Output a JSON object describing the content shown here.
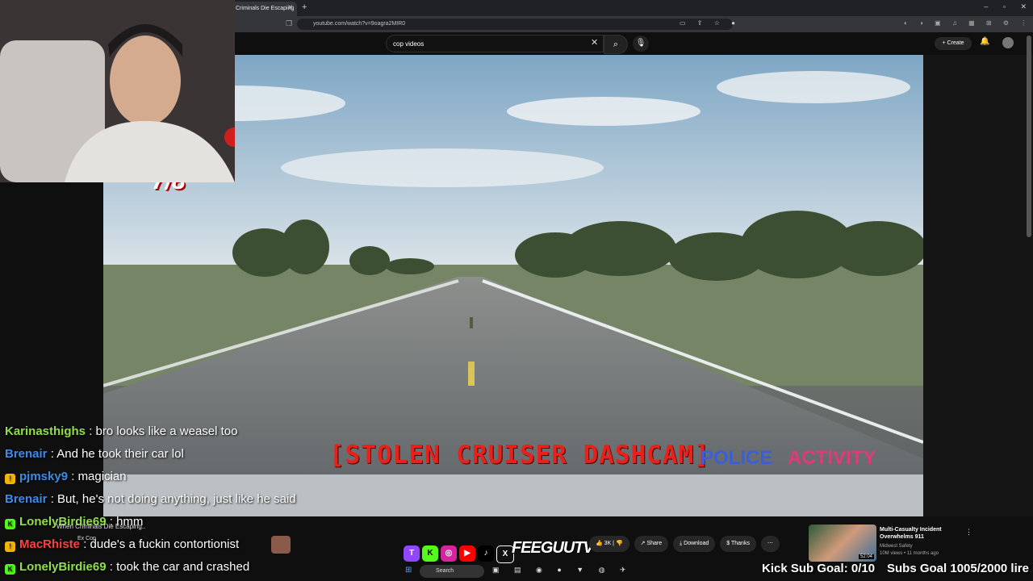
{
  "browser": {
    "tab_title": "Criminals Die Escaping",
    "url": "youtube.com/watch?v=9oagra2MIR0"
  },
  "youtube": {
    "search_value": "cop videos",
    "create_label": "Create",
    "actions": {
      "likes": "3K",
      "share": "Share",
      "download": "Download",
      "thanks": "Thanks"
    },
    "recommended": {
      "title": "Multi-Casualty Incident Overwhelms 911",
      "channel": "Midwest Safety",
      "meta": "10M views • 11 months ago",
      "duration": "52:04"
    },
    "mini_popup": {
      "video_title": "When Criminals Die Escaping..",
      "channel": "Ex Cop"
    }
  },
  "video_overlay": {
    "title": "[STOLEN CRUISER DASHCAM]",
    "brand_left": "POLICE",
    "brand_right": "ACTIVITY",
    "counter": "7/8"
  },
  "chat": [
    {
      "user": "Karinasthighs",
      "message": "bro looks like a weasel too",
      "color": "#8fe04a",
      "badge": ""
    },
    {
      "user": "Brenair",
      "message": "And he took their car lol",
      "color": "#3c8ce7",
      "badge": ""
    },
    {
      "user": "pjmsky9",
      "message": "magician",
      "color": "#3c8ce7",
      "badge": "!"
    },
    {
      "user": "Brenair",
      "message": "But, he's not doing anything, just like he said",
      "color": "#3c8ce7",
      "badge": ""
    },
    {
      "user": "LonelyBirdie69",
      "message": "hmm",
      "color": "#8fe04a",
      "badge": "K"
    },
    {
      "user": "MacRhiste",
      "message": "dude's a fuckin contortionist",
      "color": "#ff4040",
      "badge": "!"
    },
    {
      "user": "LonelyBirdie69",
      "message": "took the car and crashed",
      "color": "#8fe04a",
      "badge": "K"
    }
  ],
  "stream": {
    "brand": "FEEGUUTV",
    "kick_goal": "Kick Sub Goal: 0/10",
    "subs_goal": "Subs Goal 1005/2000 lire"
  },
  "taskbar": {
    "search_placeholder": "Search"
  },
  "colors": {
    "overlay_red": "#e8221b",
    "police_blue": "#3b5fd8",
    "activity_pink": "#e03a7a"
  }
}
